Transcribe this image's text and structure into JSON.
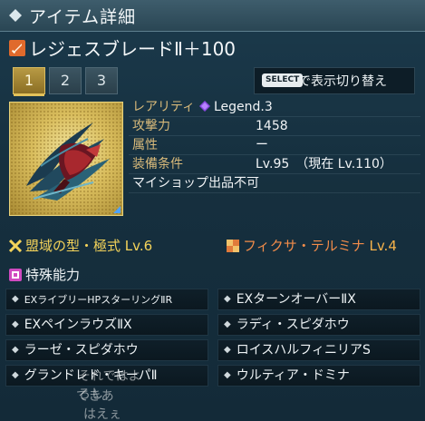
{
  "window": {
    "title": "アイテム詳細"
  },
  "item": {
    "name": "レジェスブレードⅡ＋100",
    "icon": "sword-icon"
  },
  "tabs": [
    {
      "label": "1",
      "active": true
    },
    {
      "label": "2",
      "active": false
    },
    {
      "label": "3",
      "active": false
    }
  ],
  "select_hint": {
    "badge": "SELECT",
    "text": "で表示切り替え"
  },
  "stats": {
    "rarity_label": "レアリティ",
    "rarity_value": "Legend.3",
    "attack_label": "攻撃力",
    "attack_value": "1458",
    "element_label": "属性",
    "element_value": "ー",
    "requirement_label": "装備条件",
    "requirement_value": "Lv.95　（現在 Lv.110）",
    "note": "マイショップ出品不可"
  },
  "augments": {
    "left_name": "盟域の型・極式",
    "left_level": "Lv.6",
    "right_name": "フィクサ・テルミナ",
    "right_level": "Lv.4"
  },
  "special": {
    "header": "特殊能力"
  },
  "abilities": [
    "EXライブリーHPスターリングⅡR",
    "EXターンオーバーⅡX",
    "EXペインラウズⅡX",
    "ラディ・スピダホウ",
    "ラーゼ・スピダホウ",
    "ロイスハルフィニリアS",
    "グランドレド・キーパⅡ",
    "ウルティア・ドミナ"
  ],
  "chat_overlay": [
    "それではよろし",
    "てきあ",
    "はえぇ"
  ],
  "colors": {
    "accent_gold": "#f4d35a",
    "accent_orange": "#f28c4a",
    "stat_label": "#d7b97a",
    "panel_bg": "#16303f"
  }
}
